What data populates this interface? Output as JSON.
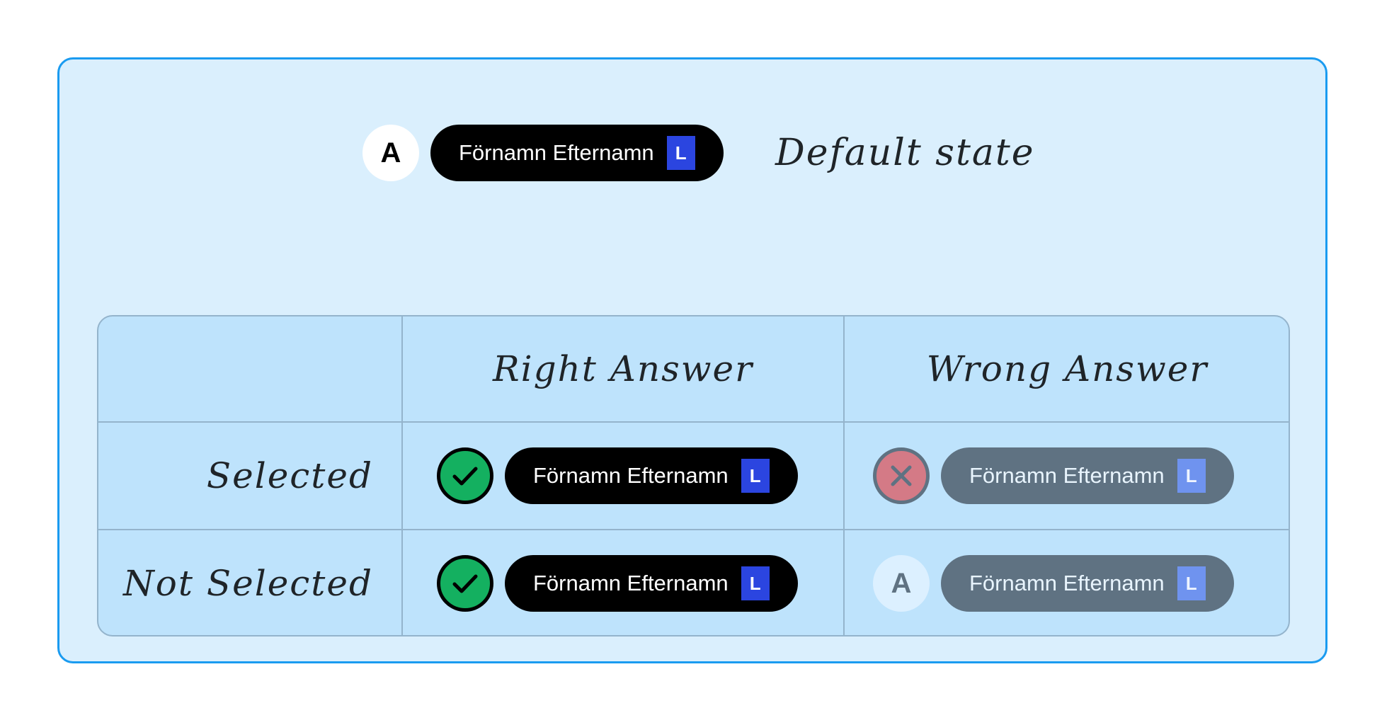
{
  "default_state": {
    "avatar_letter": "A",
    "name": "Förnamn Efternamn",
    "badge": "L",
    "label": "Default state"
  },
  "table": {
    "columns": [
      "Right Answer",
      "Wrong Answer"
    ],
    "rows": [
      {
        "label": "Selected",
        "right": {
          "icon": "check-icon",
          "name": "Förnamn Efternamn",
          "badge": "L"
        },
        "wrong": {
          "icon": "x-icon",
          "name": "Förnamn Efternamn",
          "badge": "L"
        }
      },
      {
        "label": "Not Selected",
        "right": {
          "icon": "check-icon",
          "name": "Förnamn Efternamn",
          "badge": "L"
        },
        "wrong": {
          "icon": "avatar",
          "avatar_letter": "A",
          "name": "Förnamn Efternamn",
          "badge": "L"
        }
      }
    ]
  },
  "colors": {
    "panel_border": "#1a9bf0",
    "panel_bg": "#daeffd",
    "table_bg": "#bee3fc",
    "grid": "#94b4cc",
    "pill_dark": "#000000",
    "pill_muted": "#5f7282",
    "badge_strong": "#2b45e0",
    "badge_soft": "#6f93ef",
    "correct_green": "#14b060",
    "wrong_red": "#d47a86"
  }
}
